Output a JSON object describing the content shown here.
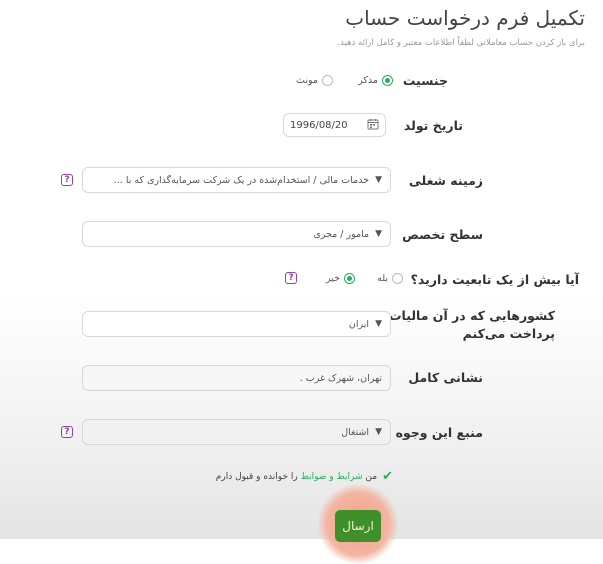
{
  "header": {
    "title": "تکمیل فرم درخواست حساب",
    "subtitle": "برای باز کردن حساب معاملاتی لطفاً اطلاعات معتبر و کامل ارائه دهید."
  },
  "gender": {
    "label": "جنسیت",
    "options": [
      {
        "label": "مذکر",
        "selected": true
      },
      {
        "label": "مونث",
        "selected": false
      }
    ]
  },
  "birthdate": {
    "label": "تاریخ تولد",
    "value": "1996/08/20"
  },
  "occupation": {
    "label": "زمینه شغلی",
    "value": "خدمات مالی / استخدام‌شده در یک شرکت سرمایه‌گذاری که با ..."
  },
  "expertise": {
    "label": "سطح تخصص",
    "value": "مامور / مجری"
  },
  "citizenship": {
    "label": "آیا بیش از یک تابعیت دارید؟",
    "options": [
      {
        "label": "بله",
        "selected": false
      },
      {
        "label": "خیر",
        "selected": true
      }
    ]
  },
  "tax_countries": {
    "label_line1": "کشورهایی که در آن مالیات",
    "label_line2": "پرداخت می‌کنم",
    "value": "ایران"
  },
  "address": {
    "label": "نشانی کامل",
    "value": "تهران، شهرک غرب ."
  },
  "funds_source": {
    "label": "منبع این وجوه",
    "value": "اشتغال"
  },
  "terms": {
    "prefix": "من ",
    "link": "شرایط و ضوابط",
    "suffix": " را خوانده و قبول دارم"
  },
  "submit": {
    "label": "ارسال"
  },
  "icons": {
    "help": "?",
    "dropdown": "▼",
    "calendar": "calendar-icon",
    "check": "✔"
  },
  "colors": {
    "accent_green": "#27ae60",
    "help_purple": "#8e44ad",
    "submit_green": "#3f8f2a"
  }
}
